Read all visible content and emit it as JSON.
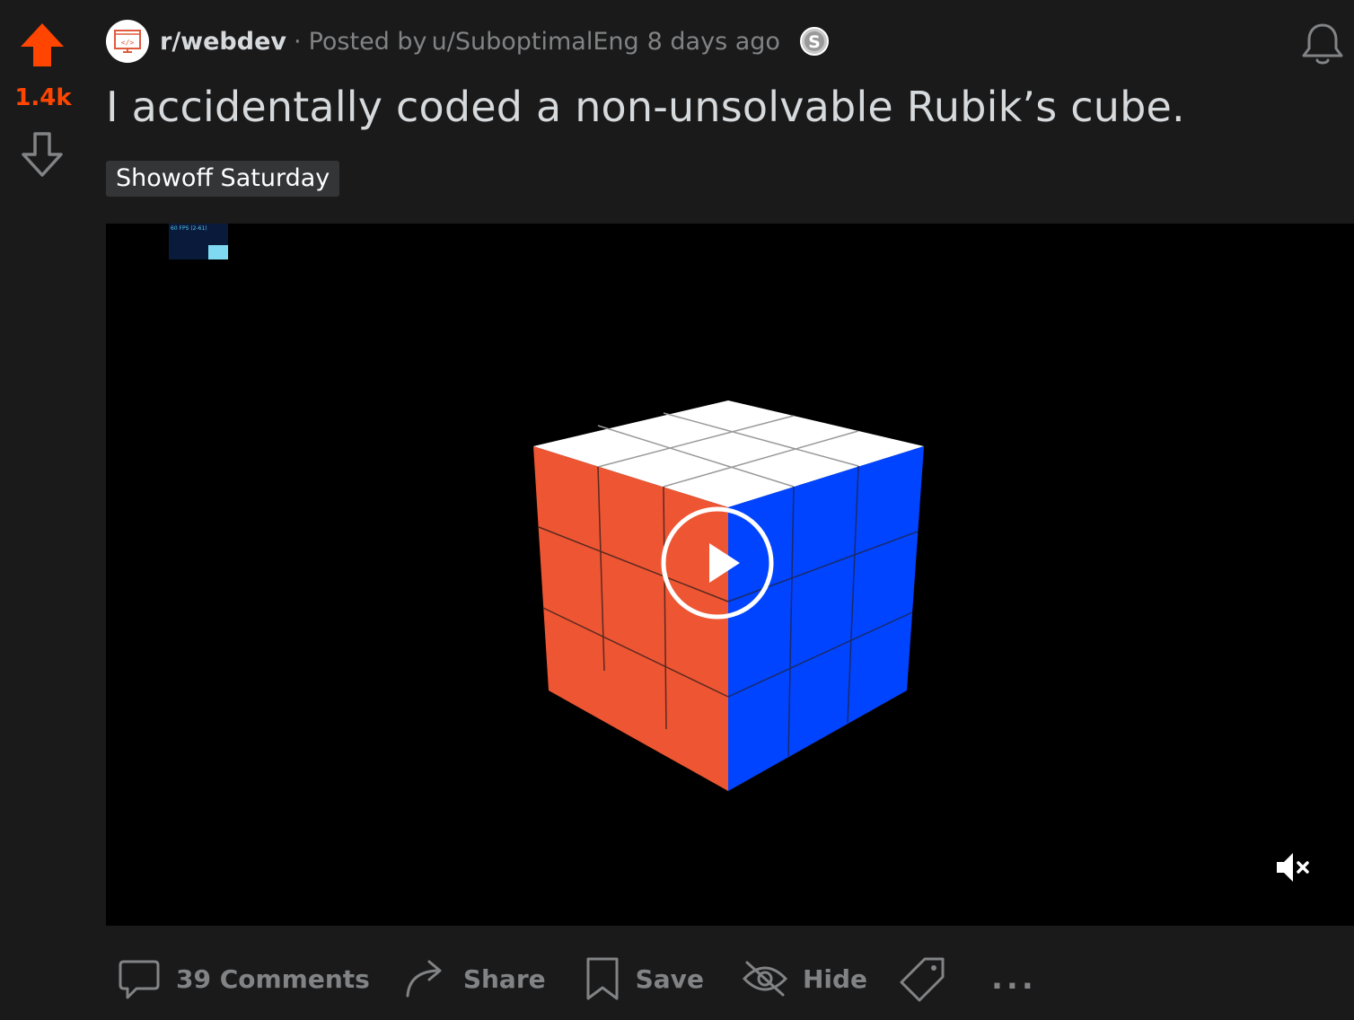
{
  "vote": {
    "score": "1.4k",
    "upvote_icon": "upvote-arrow-icon",
    "downvote_icon": "downvote-arrow-icon",
    "upvote_color": "#ff4500"
  },
  "post_meta": {
    "subreddit": "r/webdev",
    "separator": "·",
    "posted_by_prefix": "Posted by",
    "author": "u/SuboptimalEng",
    "time": "8 days ago",
    "avatar_icon": "code-window-icon",
    "award_icon": "silver-award-icon"
  },
  "notification_icon": "bell-icon",
  "post": {
    "title": "I accidentally coded a non-unsolvable Rubik’s cube.",
    "flair": "Showoff Saturday"
  },
  "video": {
    "fps_label": "60 FPS (2-61)",
    "play_icon": "play-icon",
    "mute_icon": "muted-speaker-icon",
    "cube_colors": {
      "top": "#ffffff",
      "left": "#ee5533",
      "right": "#0044ff"
    }
  },
  "actions": {
    "comments": "39 Comments",
    "share": "Share",
    "save": "Save",
    "hide": "Hide",
    "more": "..."
  }
}
